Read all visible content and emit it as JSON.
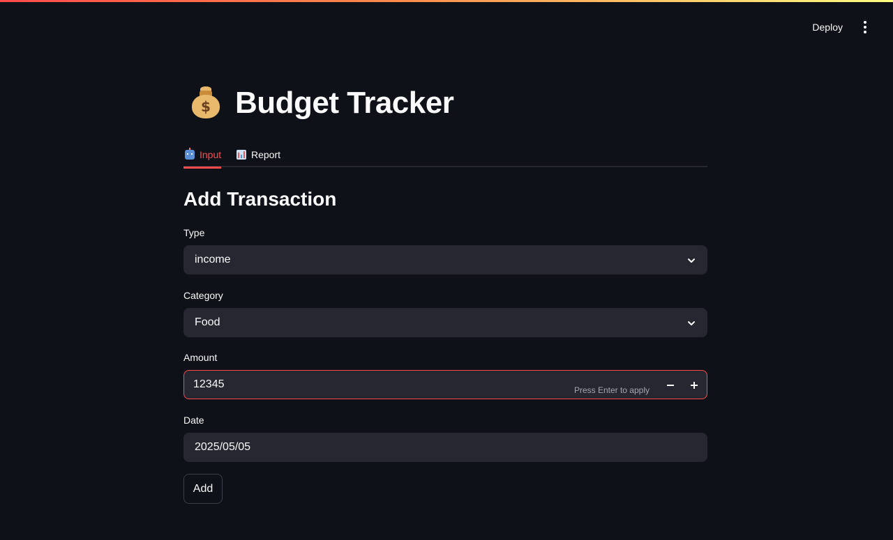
{
  "header": {
    "deploy_label": "Deploy",
    "menu_icon": "vertical-dots-icon"
  },
  "page": {
    "title": "Budget Tracker",
    "title_icon": "moneybag-icon"
  },
  "tabs": [
    {
      "label": "Input",
      "icon": "robot-icon",
      "active": true
    },
    {
      "label": "Report",
      "icon": "bar-chart-icon",
      "active": false
    }
  ],
  "form": {
    "heading": "Add Transaction",
    "type": {
      "label": "Type",
      "value": "income"
    },
    "category": {
      "label": "Category",
      "value": "Food"
    },
    "amount": {
      "label": "Amount",
      "value": "12345",
      "hint": "Press Enter to apply"
    },
    "date": {
      "label": "Date",
      "value": "2025/05/05"
    },
    "submit_label": "Add"
  },
  "colors": {
    "background": "#0e1117",
    "field_background": "#262730",
    "accent": "#ff4b4b",
    "text": "#fafafa"
  }
}
